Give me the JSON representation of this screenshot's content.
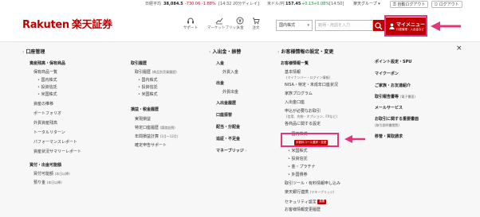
{
  "ticker": {
    "nikkei_label": "日経平均",
    "nikkei_value": "38,084.5",
    "nikkei_change": "-730.06",
    "nikkei_pct": "-1.88%",
    "nikkei_time": "[14:32 20分ディレイ]",
    "usdjpy_label": "米ドル/円",
    "usdjpy_value": "157.45",
    "usdjpy_change": "+0.13",
    "usdjpy_pct": "+0.08%",
    "usdjpy_time": "[14:50]",
    "group_label": "楽天グループ",
    "auto_logout": "自動ログアウト",
    "logout": "ログアウト"
  },
  "header": {
    "logo_en": "Rakuten",
    "logo_jp": "楽天証券",
    "icons": [
      {
        "name": "support",
        "label": "サポート",
        "icon": "headset-icon"
      },
      {
        "name": "marketbridge",
        "label": "マーケットブリッジ",
        "icon": "chart-icon"
      },
      {
        "name": "deposit",
        "label": "入金",
        "icon": "yen-icon"
      },
      {
        "name": "order",
        "label": "注文",
        "icon": "cart-icon"
      }
    ],
    "search_category": "国内株式",
    "search_placeholder": "銘柄・用語を入力",
    "mymenu_title": "マイメニュー",
    "mymenu_sub": "口座管理・入出金など"
  },
  "menu": {
    "col1": {
      "title": "口座管理",
      "cat1": "資産残高・保有商品",
      "items1": [
        "保有商品一覧",
        "国内株式",
        "投資信託",
        "米国株式",
        "資産の推移",
        "ポートフォリオ",
        "外貨資産残高",
        "トータルリターン",
        "パフォーマンスレポート",
        "資産状況サマリーレポート"
      ],
      "cat2": "買付・出金可能額",
      "items2": [
        "買付可能額",
        "預り金"
      ],
      "items2_sub": [
        "(本日以降)",
        "(本日以降)"
      ]
    },
    "col2": {
      "cat1": "取引履歴",
      "items1": [
        "取引履歴",
        "国内株式",
        "投資信託",
        "米国株式"
      ],
      "items1_sub": "(商品別売買履歴)",
      "cat2": "損益・税金履歴",
      "items2": [
        "実現損益",
        "特定口座履歴",
        "年間損益計算",
        "確定申告サポート"
      ],
      "items2_subs": [
        "",
        "(譲渡益税)",
        "(1月〜12月)",
        ""
      ]
    },
    "col3": {
      "title": "入出金・振替",
      "items": [
        "入金",
        "外貨入金",
        "出金",
        "外貨出金",
        "入出金履歴",
        "口座振替",
        "配当・分配金",
        "追証・不足金",
        "マネーブリッジ"
      ]
    },
    "col4": {
      "title": "お客様情報の設定・変更",
      "cat1": "お客様情報一覧",
      "items": [
        "基本情報",
        "NISA・特定・未成年口座状況",
        "家族プログラム",
        "入出金口座",
        "申込が必要なお取引",
        "各商品に関する設定",
        "国内株式",
        "投資信託",
        "金・プラチナ",
        "外国債券",
        "取引ツール・有料情報申し込み",
        "楽天銀行連携",
        "セキュリティ設定",
        "お客様情報変更履歴"
      ],
      "sub_basic": "(マイナンバー・ログイン情報)",
      "sub_apply": "(信用、先物・オプション、FXなど)",
      "sub_rbank": "(マネーブリッジ)",
      "badge_domestic": "手数料コース選択・変更",
      "badge_security": "重要",
      "bullet_us": "米国株式"
    },
    "col5": {
      "items": [
        "ポイント設定・SPU",
        "マイクーポン",
        "ご家族・お友達紹介",
        "取引報告書等",
        "メールサービス",
        "お取引に関する重要書面",
        "移管・買取請求"
      ],
      "sub_report": "(電子書面)",
      "sub_docs": "(取引説明書閲覧)"
    },
    "close_label": "×"
  }
}
